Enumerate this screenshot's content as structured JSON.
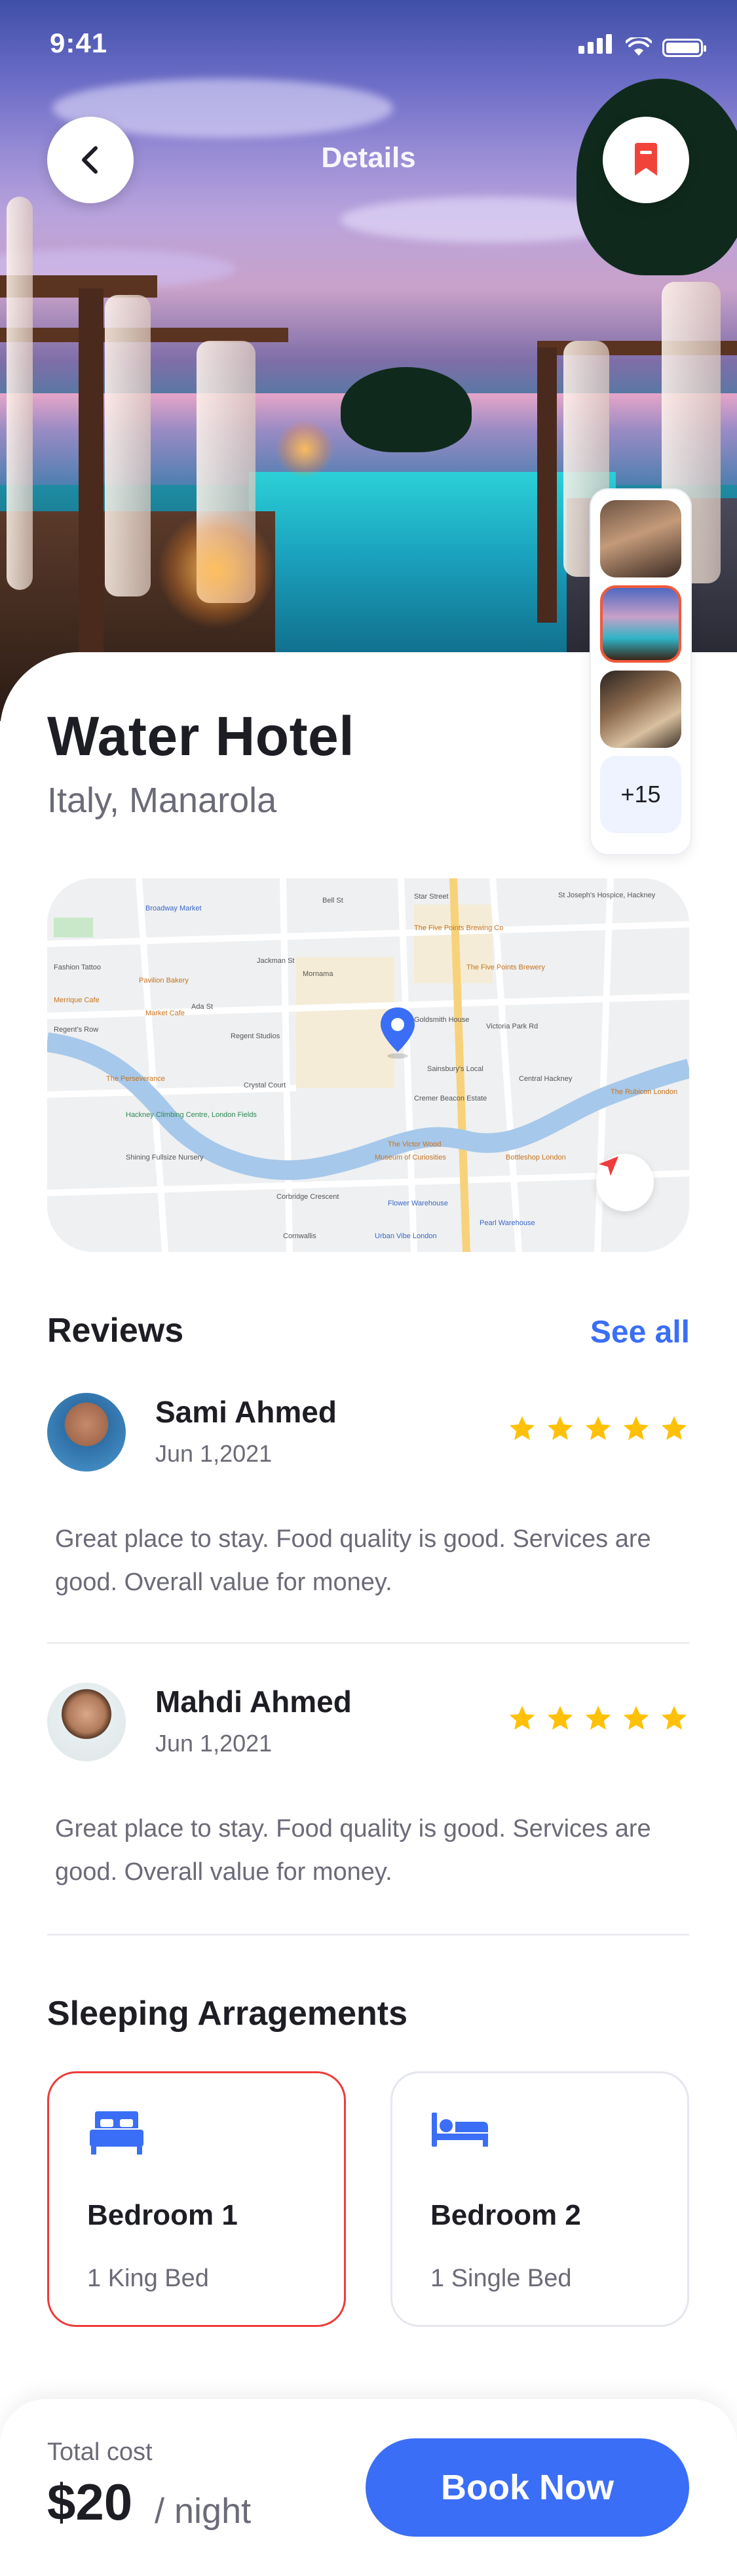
{
  "status_bar": {
    "time": "9:41"
  },
  "header": {
    "title": "Details"
  },
  "hotel": {
    "name": "Water Hotel",
    "location": "Italy, Manarola",
    "more_photos": "+15"
  },
  "map": {
    "labels": [
      "Broadway Market",
      "Bell St",
      "Star Street",
      "St Joseph's Hospice, Hackney",
      "Fashion Tattoo",
      "Pavilion Bakery",
      "The Five Points Brewing Co",
      "Jackman St",
      "Mornama",
      "The Five Points Brewery",
      "Merrique Cafe",
      "Market Cafe",
      "Ada St",
      "Regent Studios",
      "Goldsmith House",
      "Regent's Row",
      "The Perseverance",
      "Crystal Court",
      "Sainsbury's Local",
      "Victoria Park Rd",
      "Central Hackney",
      "Cremer Beacon Estate",
      "The Rubicon London",
      "Hackney Climbing Centre, London Fields",
      "Shining Fullsize Nursery",
      "The Victor Wood",
      "Museum of Curiosities",
      "Bottleshop London",
      "Corbridge Crescent",
      "Flower Warehouse",
      "Pearl Warehouse",
      "Urban Vibe London",
      "Cornwallis"
    ]
  },
  "reviews": {
    "title": "Reviews",
    "see_all": "See all",
    "items": [
      {
        "name": "Sami Ahmed",
        "date": "Jun 1,2021",
        "rating": 5,
        "text": "Great place to stay. Food quality is good. Services are good. Overall value for money."
      },
      {
        "name": "Mahdi Ahmed",
        "date": "Jun 1,2021",
        "rating": 5,
        "text": "Great place to stay. Food quality is good. Services are good. Overall value for money."
      }
    ]
  },
  "sleeping": {
    "title": "Sleeping Arragements",
    "rooms": [
      {
        "name": "Bedroom 1",
        "beds": "1 King Bed",
        "selected": true
      },
      {
        "name": "Bedroom 2",
        "beds": "1 Single Bed",
        "selected": false
      }
    ]
  },
  "booking": {
    "cost_label": "Total cost",
    "price": "$20",
    "per": "/ night",
    "button": "Book Now"
  },
  "colors": {
    "accent": "#3b6ef6",
    "selected_border": "#ef3b3b",
    "star": "#ffc107",
    "bookmark": "#f0443a"
  },
  "icons": [
    "back-icon",
    "bookmark-icon",
    "map-pin-icon",
    "navigation-arrow-icon",
    "star-icon",
    "double-bed-icon",
    "single-bed-icon"
  ]
}
